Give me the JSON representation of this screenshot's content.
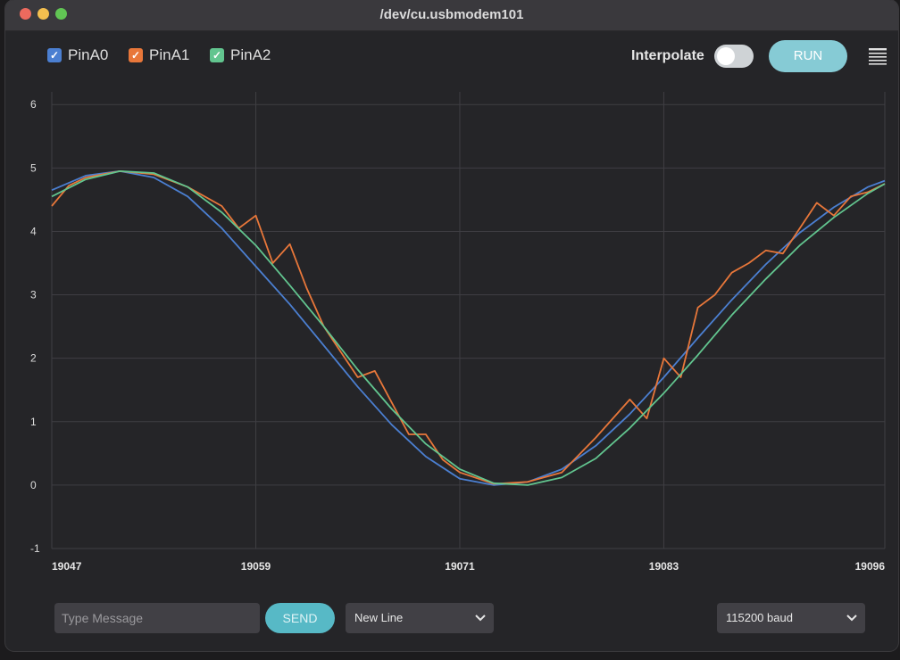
{
  "window": {
    "title": "/dev/cu.usbmodem101"
  },
  "toolbar": {
    "legend": [
      {
        "label": "PinA0",
        "color": "#4b7fd1"
      },
      {
        "label": "PinA1",
        "color": "#e8773a"
      },
      {
        "label": "PinA2",
        "color": "#62c58f"
      }
    ],
    "interpolate_label": "Interpolate",
    "interpolate_on": false,
    "run_label": "RUN",
    "menu_icon": "menu-icon"
  },
  "bottom": {
    "message_placeholder": "Type Message",
    "send_label": "SEND",
    "line_ending": "New Line",
    "baud": "115200 baud"
  },
  "chart_data": {
    "type": "line",
    "x_ticks": [
      "19047",
      "19059",
      "19071",
      "19083",
      "19096"
    ],
    "y_ticks": [
      "6",
      "5",
      "4",
      "3",
      "2",
      "1",
      "0",
      "-1"
    ],
    "xlim": [
      19047,
      19096
    ],
    "ylim": [
      -1,
      6.2
    ],
    "grid": true,
    "legend_position": "top-left",
    "series": [
      {
        "name": "PinA0",
        "color": "#4b7fd1",
        "x": [
          19047,
          19049,
          19051,
          19053,
          19055,
          19057,
          19059,
          19061,
          19063,
          19065,
          19067,
          19069,
          19071,
          19073,
          19075,
          19077,
          19079,
          19081,
          19083,
          19085,
          19087,
          19089,
          19091,
          19093,
          19095,
          19096
        ],
        "y": [
          4.65,
          4.88,
          4.95,
          4.85,
          4.55,
          4.05,
          3.45,
          2.85,
          2.2,
          1.55,
          0.95,
          0.45,
          0.1,
          0,
          0.05,
          0.25,
          0.62,
          1.12,
          1.7,
          2.32,
          2.92,
          3.48,
          3.98,
          4.38,
          4.7,
          4.8
        ]
      },
      {
        "name": "PinA1",
        "color": "#e8773a",
        "x": [
          19047,
          19048,
          19049,
          19051,
          19053,
          19055,
          19057,
          19058,
          19059,
          19060,
          19061,
          19062,
          19063,
          19064,
          19065,
          19066,
          19067,
          19068,
          19069,
          19070,
          19071,
          19073,
          19075,
          19077,
          19079,
          19081,
          19082,
          19083,
          19084,
          19085,
          19086,
          19087,
          19088,
          19089,
          19090,
          19091,
          19092,
          19093,
          19094,
          19095,
          19096
        ],
        "y": [
          4.4,
          4.72,
          4.85,
          4.95,
          4.9,
          4.7,
          4.4,
          4.05,
          4.25,
          3.5,
          3.8,
          3.1,
          2.5,
          2.1,
          1.7,
          1.8,
          1.3,
          0.8,
          0.8,
          0.4,
          0.2,
          0.02,
          0.05,
          0.2,
          0.75,
          1.35,
          1.05,
          2.0,
          1.7,
          2.8,
          3.0,
          3.35,
          3.5,
          3.7,
          3.65,
          4.05,
          4.45,
          4.25,
          4.55,
          4.62,
          4.75
        ]
      },
      {
        "name": "PinA2",
        "color": "#62c58f",
        "x": [
          19047,
          19049,
          19051,
          19053,
          19055,
          19057,
          19059,
          19061,
          19063,
          19065,
          19067,
          19069,
          19071,
          19073,
          19075,
          19077,
          19079,
          19081,
          19083,
          19085,
          19087,
          19089,
          19091,
          19093,
          19095,
          19096
        ],
        "y": [
          4.55,
          4.82,
          4.95,
          4.92,
          4.7,
          4.3,
          3.78,
          3.15,
          2.5,
          1.82,
          1.2,
          0.65,
          0.25,
          0.03,
          0,
          0.12,
          0.42,
          0.9,
          1.45,
          2.05,
          2.68,
          3.25,
          3.78,
          4.22,
          4.6,
          4.75
        ]
      }
    ]
  }
}
